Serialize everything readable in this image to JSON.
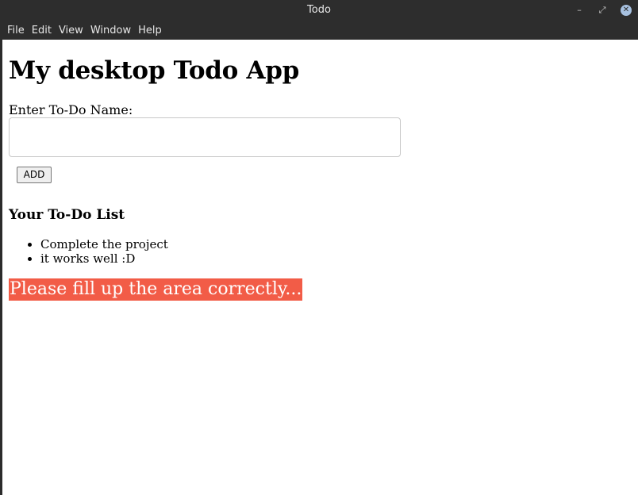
{
  "window": {
    "title": "Todo",
    "controls": {
      "minimize": "–",
      "maximize": "⤢",
      "close": "✕"
    }
  },
  "menu": [
    "File",
    "Edit",
    "View",
    "Window",
    "Help"
  ],
  "page": {
    "heading": "My desktop Todo App",
    "field_label": "Enter To-Do Name:",
    "input_value": "",
    "add_label": "ADD",
    "list_heading": "Your To-Do List",
    "items": [
      "Complete the project",
      "it works well :D"
    ],
    "error_message": "Please fill up the area correctly..."
  },
  "colors": {
    "titlebar": "#2d2d2d",
    "error_bg": "#f25c47",
    "error_text": "#ffffff",
    "close_button": "#a7c1e0"
  }
}
